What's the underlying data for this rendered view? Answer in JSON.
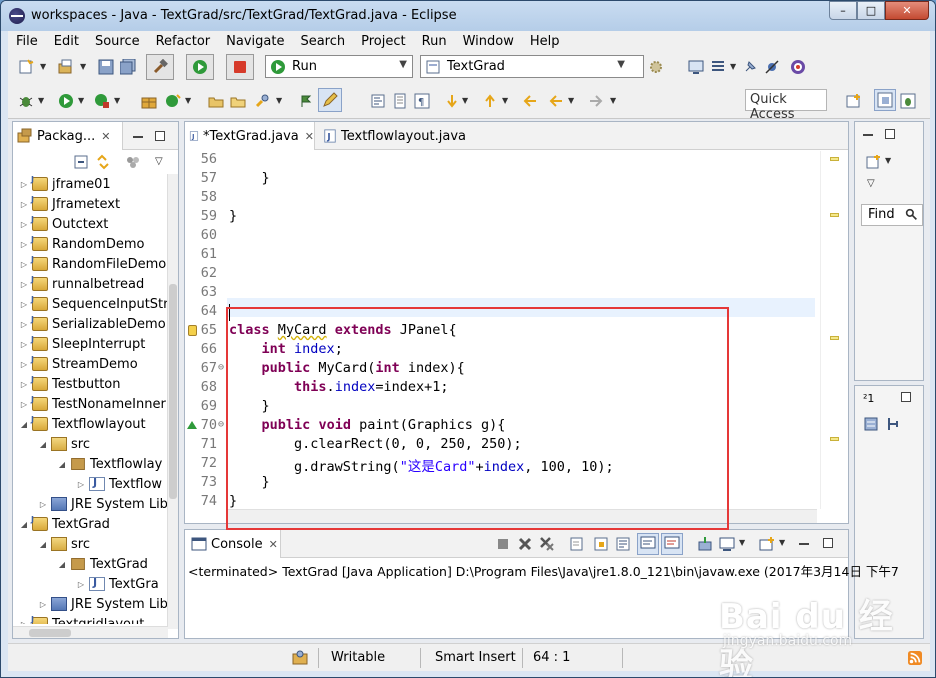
{
  "window": {
    "title": "workspaces - Java - TextGrad/src/TextGrad/TextGrad.java - Eclipse",
    "minimize": "–",
    "maximize": "□",
    "close": "✕"
  },
  "menu": [
    "File",
    "Edit",
    "Source",
    "Refactor",
    "Navigate",
    "Search",
    "Project",
    "Run",
    "Window",
    "Help"
  ],
  "toolbar": {
    "run_combo": "Run",
    "launch_combo": "TextGrad",
    "quick_access": "Quick Access"
  },
  "package_explorer": {
    "tab_label": "Packag...",
    "items": [
      {
        "label": "jframe01",
        "kind": "project",
        "expanded": false
      },
      {
        "label": "Jframetext",
        "kind": "project",
        "expanded": false
      },
      {
        "label": "Outctext",
        "kind": "project",
        "expanded": false
      },
      {
        "label": "RandomDemo",
        "kind": "project",
        "expanded": false
      },
      {
        "label": "RandomFileDemo",
        "kind": "project",
        "expanded": false
      },
      {
        "label": "runnalbetread",
        "kind": "project",
        "expanded": false
      },
      {
        "label": "SequenceInputStr",
        "kind": "project",
        "expanded": false
      },
      {
        "label": "SerializableDemo",
        "kind": "project",
        "expanded": false
      },
      {
        "label": "SleepInterrupt",
        "kind": "project",
        "expanded": false
      },
      {
        "label": "StreamDemo",
        "kind": "project",
        "expanded": false
      },
      {
        "label": "Testbutton",
        "kind": "project",
        "expanded": false
      },
      {
        "label": "TestNonameInner",
        "kind": "project",
        "expanded": false
      },
      {
        "label": "Textflowlayout",
        "kind": "project",
        "expanded": true
      },
      {
        "label": "src",
        "kind": "src",
        "expanded": true
      },
      {
        "label": "Textflowlay",
        "kind": "package",
        "expanded": true
      },
      {
        "label": "Textflow",
        "kind": "java",
        "expanded": false
      },
      {
        "label": "JRE System Lib",
        "kind": "jre",
        "expanded": false
      },
      {
        "label": "TextGrad",
        "kind": "project",
        "expanded": true
      },
      {
        "label": "src",
        "kind": "src",
        "expanded": true
      },
      {
        "label": "TextGrad",
        "kind": "package",
        "expanded": true
      },
      {
        "label": "TextGra",
        "kind": "java",
        "expanded": false
      },
      {
        "label": "JRE System Lib",
        "kind": "jre",
        "expanded": false
      },
      {
        "label": "Textgridlayout",
        "kind": "project",
        "expanded": false
      }
    ]
  },
  "editor": {
    "tabs": [
      {
        "label": "*TextGrad.java",
        "active": true
      },
      {
        "label": "Textflowlayout.java",
        "active": false
      }
    ],
    "lines": [
      {
        "n": "56",
        "code": ""
      },
      {
        "n": "57",
        "code": "    }"
      },
      {
        "n": "58",
        "code": ""
      },
      {
        "n": "59",
        "code": "}"
      },
      {
        "n": "60",
        "code": ""
      },
      {
        "n": "61",
        "code": ""
      },
      {
        "n": "62",
        "code": ""
      },
      {
        "n": "63",
        "code": ""
      },
      {
        "n": "64",
        "code": ""
      },
      {
        "n": "65",
        "code": "class MyCard extends JPanel{"
      },
      {
        "n": "66",
        "code": "    int index;"
      },
      {
        "n": "67",
        "code": "    public MyCard(int index){"
      },
      {
        "n": "68",
        "code": "        this.index=index+1;"
      },
      {
        "n": "69",
        "code": "    }"
      },
      {
        "n": "70",
        "code": "    public void paint(Graphics g){"
      },
      {
        "n": "71",
        "code": "        g.clearRect(0, 0, 250, 250);"
      },
      {
        "n": "72",
        "code": "        g.drawString(\"这是Card\"+index, 100, 10);"
      },
      {
        "n": "73",
        "code": "    }"
      },
      {
        "n": "74",
        "code": "}"
      }
    ]
  },
  "right_panel": {
    "find_label": "Find",
    "num_label": "1"
  },
  "console": {
    "tab_label": "Console",
    "output": "<terminated> TextGrad [Java Application] D:\\Program Files\\Java\\jre1.8.0_121\\bin\\javaw.exe (2017年3月14日 下午7"
  },
  "status": {
    "writable": "Writable",
    "insert_mode": "Smart Insert",
    "position": "64 : 1"
  },
  "watermark": {
    "main": "Bai du 经验",
    "sub": "jingyan.baidu.com"
  }
}
